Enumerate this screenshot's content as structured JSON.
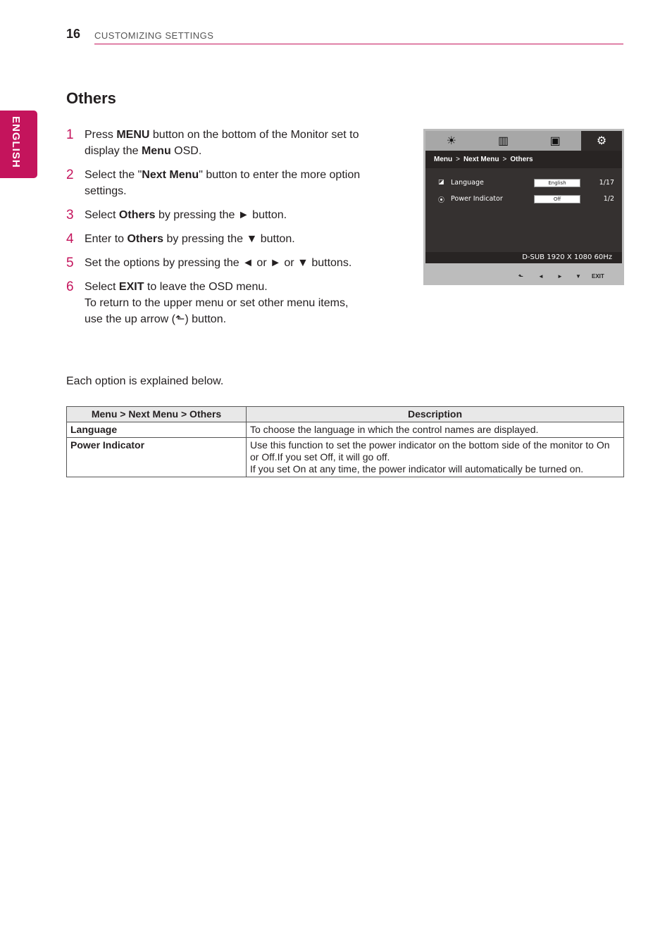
{
  "header": {
    "page_number": "16",
    "section": "CUSTOMIZING SETTINGS"
  },
  "side_tab": {
    "label": "ENGLISH"
  },
  "title": "Others",
  "steps": [
    {
      "num": "1",
      "parts": [
        [
          "Press ",
          false
        ],
        [
          "MENU",
          true
        ],
        [
          " button on the bottom of the Monitor set to display the ",
          false
        ],
        [
          "Menu",
          true
        ],
        [
          " OSD.",
          false
        ]
      ]
    },
    {
      "num": "2",
      "parts": [
        [
          "Select the \"",
          false
        ],
        [
          "Next Menu",
          true
        ],
        [
          "\" button to enter the more option settings.",
          false
        ]
      ]
    },
    {
      "num": "3",
      "parts": [
        [
          "Select ",
          false
        ],
        [
          "Others",
          true
        ],
        [
          " by pressing the ► button.",
          false
        ]
      ]
    },
    {
      "num": "4",
      "parts": [
        [
          "Enter to ",
          false
        ],
        [
          "Others",
          true
        ],
        [
          " by pressing the ▼ button.",
          false
        ]
      ]
    },
    {
      "num": "5",
      "parts": [
        [
          "Set the options by pressing the ◄ or ► or ▼ buttons.",
          false
        ]
      ]
    },
    {
      "num": "6",
      "parts": [
        [
          "Select ",
          false
        ],
        [
          "EXIT",
          true
        ],
        [
          " to leave the OSD menu.",
          false
        ],
        [
          "\nTo return to the upper menu or set other menu items, use the up arrow (⬑) button.",
          false
        ]
      ]
    }
  ],
  "intro": "Each option is explained below.",
  "table": {
    "headers": [
      "Menu > Next Menu > Others",
      "Description"
    ],
    "rows": [
      [
        "Language",
        "To choose the language in which the control names are displayed."
      ],
      [
        "Power Indicator",
        "Use this function to set the power indicator on the bottom side of the monitor to On or Off.If you set Off, it will go off.\nIf you set On at any time, the power indicator will automatically be turned on."
      ]
    ]
  },
  "osd": {
    "tabs": [
      {
        "icon": "brightness-icon",
        "glyph": "☀"
      },
      {
        "icon": "color-bars-icon",
        "glyph": "▥"
      },
      {
        "icon": "picture-icon",
        "glyph": "▣"
      },
      {
        "icon": "gear-icon",
        "glyph": "⚙"
      }
    ],
    "breadcrumb": [
      "Menu",
      "Next Menu",
      "Others"
    ],
    "breadcrumb_sep": ">",
    "rows": [
      {
        "icon": "◪",
        "label": "Language",
        "value": "English",
        "count": "1/17"
      },
      {
        "icon": "⦿",
        "label": "Power Indicator",
        "value": "Off",
        "count": "1/2"
      }
    ],
    "status": "D-SUB 1920 X 1080 60Hz",
    "buttons": [
      "⬑",
      "◄",
      "►",
      "▼",
      "EXIT"
    ]
  }
}
